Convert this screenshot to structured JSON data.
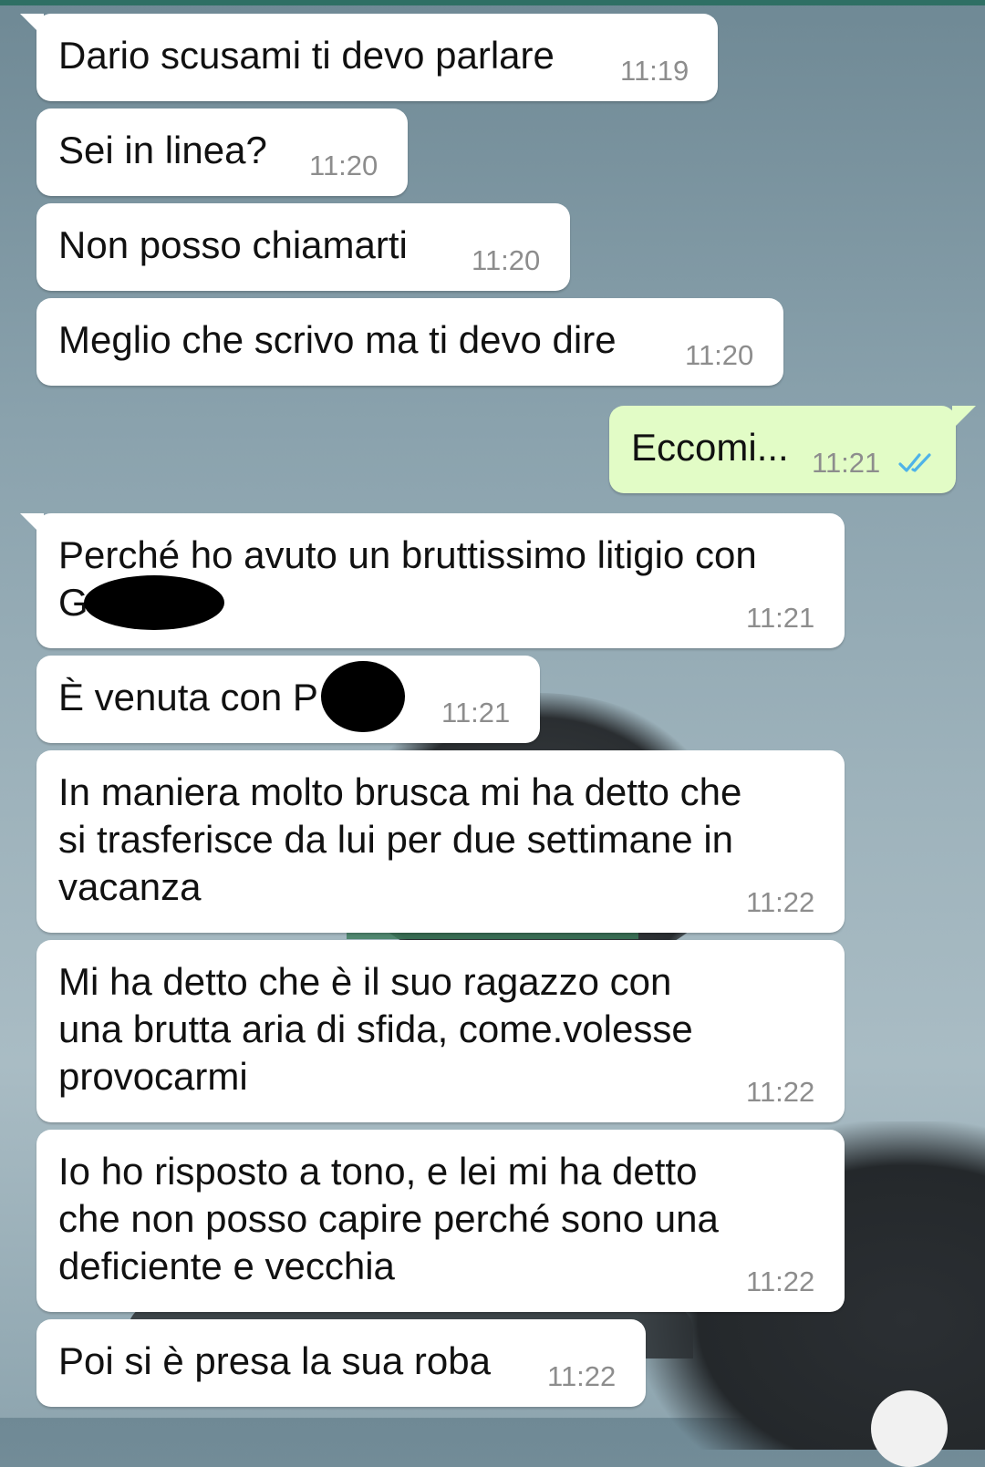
{
  "chat": {
    "messages": [
      {
        "text": "Dario scusami ti devo parlare",
        "time": "11:19",
        "dir": "in"
      },
      {
        "text": "Sei in linea?",
        "time": "11:20",
        "dir": "in"
      },
      {
        "text": "Non posso chiamarti",
        "time": "11:20",
        "dir": "in"
      },
      {
        "text": "Meglio che scrivo ma ti devo dire",
        "time": "11:20",
        "dir": "in"
      },
      {
        "text": "Eccomi...",
        "time": "11:21",
        "dir": "out",
        "status": "read"
      },
      {
        "text": "Perché ho avuto un bruttissimo litigio con\nG",
        "time": "11:21",
        "dir": "in"
      },
      {
        "text": "È venuta con P",
        "time": "11:21",
        "dir": "in"
      },
      {
        "text": "In maniera molto brusca mi ha detto che\nsi trasferisce da lui per due settimane in\nvacanza",
        "time": "11:22",
        "dir": "in"
      },
      {
        "text": "Mi ha detto che è il suo ragazzo con\nuna brutta aria di sfida, come.volesse\nprovocarmi",
        "time": "11:22",
        "dir": "in"
      },
      {
        "text": "Io ho risposto a tono, e lei mi ha detto\nche non posso capire perché sono una\ndeficiente e vecchia",
        "time": "11:22",
        "dir": "in"
      },
      {
        "text": "Poi si è presa la sua roba",
        "time": "11:22",
        "dir": "in"
      }
    ]
  },
  "colors": {
    "incoming_bubble": "#ffffff",
    "outgoing_bubble": "#e2fcc6",
    "read_ticks": "#4fb3e8",
    "time_text": "#8d8d8d"
  },
  "icons": {
    "read_receipt": "double-check-icon"
  }
}
